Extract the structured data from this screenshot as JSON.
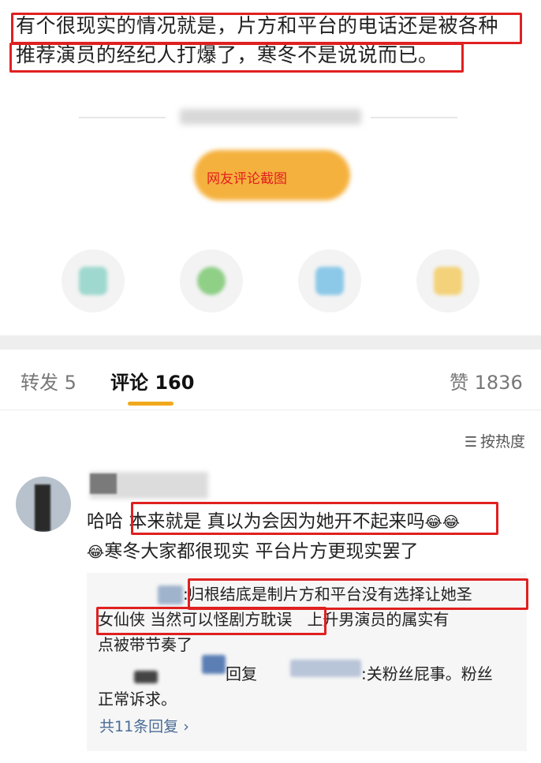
{
  "post": {
    "line1": "有个很现实的情况就是，片方和平台的电话还是被各种",
    "line2": "推荐演员的经纪人打爆了，寒冬不是说说而已。"
  },
  "watermark_caption": "网友评论截图",
  "action_icons": [
    "share-icon",
    "comment-icon",
    "like-icon",
    "favorite-icon"
  ],
  "tabs": [
    {
      "label": "转发",
      "count": "5"
    },
    {
      "label": "评论",
      "count": "160"
    },
    {
      "label": "赞",
      "count": "1836"
    }
  ],
  "sort_label": "按热度",
  "comment": {
    "line1_prefix": "哈哈 ",
    "line1_highlight": "本来就是 真以为会因为她开不起来吗",
    "line2": "寒冬大家都很现实 平台片方更现实罢了",
    "emoji": "😂"
  },
  "reply1": {
    "colon": ":",
    "highlight_a": "归根结底是制片方和平台没有选择让她圣",
    "highlight_b": "女仙侠 当然可以怪剧方耽误",
    "rest_a": "上升男演员的属实有",
    "rest_b": "点被带节奏了"
  },
  "reply2": {
    "reply_word": "回复",
    "content_a": ":关粉丝屁事。粉丝",
    "content_b": "正常诉求。"
  },
  "more_replies": "共11条回复 ›",
  "colors": {
    "accent": "#f0a91c",
    "highlight_box": "#e02020",
    "link": "#4a6c95"
  }
}
